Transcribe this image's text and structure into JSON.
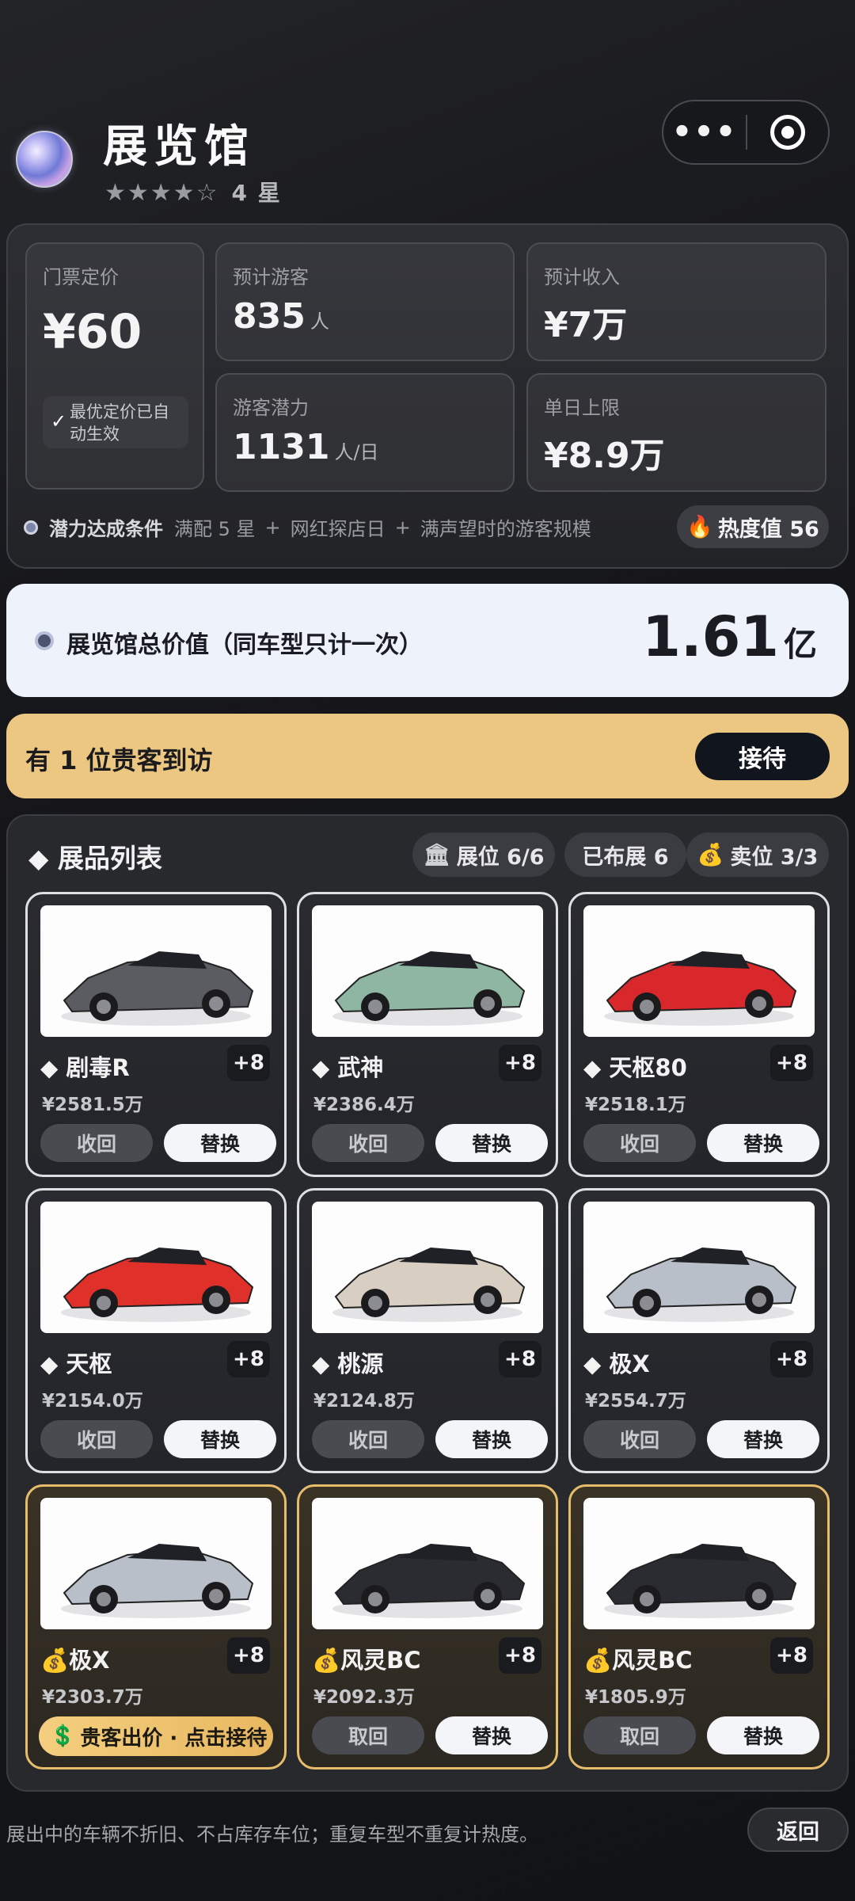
{
  "header": {
    "title": "展览馆",
    "stars": "★★★★☆",
    "star_label": "4 星",
    "more": "•••"
  },
  "stats": {
    "ticket_label": "门票定价",
    "ticket_value": "¥60",
    "ticket_tip": "最优定价已自动生效",
    "visitors_label": "预计游客",
    "visitors_value": "835",
    "visitors_unit": "人",
    "income_label": "预计收入",
    "income_value": "¥7万",
    "potential_label": "游客潜力",
    "potential_value": "1131",
    "potential_unit": "人/日",
    "daily_cap_label": "单日上限",
    "daily_cap_value": "¥8.9万"
  },
  "condition": {
    "label": "潜力达成条件",
    "items": [
      "满配 5 星",
      "+",
      "网红探店日",
      "+",
      "满声望时的游客规模"
    ]
  },
  "heat": {
    "icon": "fire-icon",
    "label": "热度值 56"
  },
  "total_value": {
    "label": "展览馆总价值（同车型只计一次）",
    "value": "1.61",
    "unit": "亿"
  },
  "guest": {
    "text": "有 1 位贵客到访",
    "button": "接待"
  },
  "exhibits": {
    "title": "◆ 展品列表",
    "pills": {
      "slots": "展位 6/6",
      "displayed": "已布展 6",
      "selling": "卖位 3/3"
    },
    "cards": [
      {
        "name": "◆ 剧毒R",
        "plus": "+8",
        "price": "¥2581.5万",
        "left_btn": "收回",
        "right_btn": "替换",
        "color": "#5b5c61",
        "gold": false
      },
      {
        "name": "◆ 武神",
        "plus": "+8",
        "price": "¥2386.4万",
        "left_btn": "收回",
        "right_btn": "替换",
        "color": "#8fb6a2",
        "gold": false
      },
      {
        "name": "◆ 天枢80",
        "plus": "+8",
        "price": "¥2518.1万",
        "left_btn": "收回",
        "right_btn": "替换",
        "color": "#d9282b",
        "gold": false
      },
      {
        "name": "◆ 天枢",
        "plus": "+8",
        "price": "¥2154.0万",
        "left_btn": "收回",
        "right_btn": "替换",
        "color": "#e0302a",
        "gold": false
      },
      {
        "name": "◆ 桃源",
        "plus": "+8",
        "price": "¥2124.8万",
        "left_btn": "收回",
        "right_btn": "替换",
        "color": "#d8cfc2",
        "gold": false
      },
      {
        "name": "◆ 极X",
        "plus": "+8",
        "price": "¥2554.7万",
        "left_btn": "收回",
        "right_btn": "替换",
        "color": "#b9bfc8",
        "gold": false
      },
      {
        "name": "极X",
        "plus": "+8",
        "price": "¥2303.7万",
        "offer": "贵客出价 · 点击接待",
        "color": "#b9bfc8",
        "gold": true
      },
      {
        "name": "风灵BC",
        "plus": "+8",
        "price": "¥2092.3万",
        "left_btn": "取回",
        "right_btn": "替换",
        "color": "#2a2c32",
        "gold": true
      },
      {
        "name": "风灵BC",
        "plus": "+8",
        "price": "¥1805.9万",
        "left_btn": "取回",
        "right_btn": "替换",
        "color": "#2a2c32",
        "gold": true
      }
    ]
  },
  "footer": {
    "note": "展出中的车辆不折旧、不占库存车位；重复车型不重复计热度。",
    "back": "返回"
  }
}
